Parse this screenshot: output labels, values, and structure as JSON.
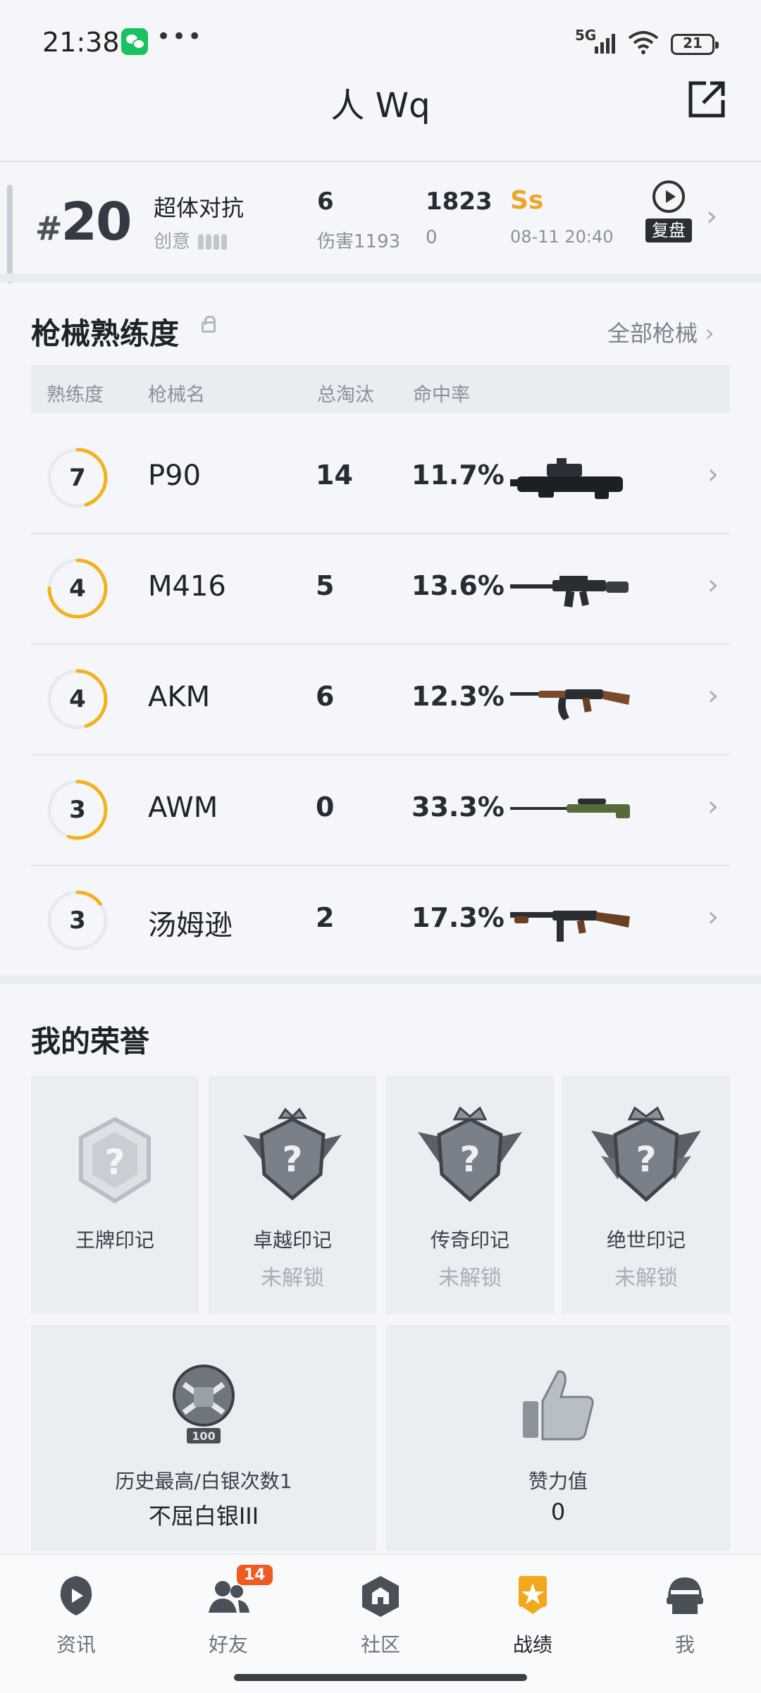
{
  "status_bar": {
    "time": "21:38",
    "network": "5G",
    "battery": "21"
  },
  "header": {
    "title": "人 Wq"
  },
  "match": {
    "rank": "20",
    "rank_hash": "#",
    "mode": "超体对抗",
    "submode": "创意",
    "kills": "6",
    "damage": "伤害1193",
    "score": "1823",
    "score_sub": "0",
    "grade": "Ss",
    "time": "08-11 20:40",
    "replay_label": "复盘"
  },
  "weapons": {
    "title": "枪械熟练度",
    "all_link": "全部枪械",
    "headers": {
      "mastery": "熟练度",
      "name": "枪械名",
      "kills": "总淘汰",
      "accuracy": "命中率"
    },
    "rows": [
      {
        "level": "7",
        "name": "P90",
        "kills": "14",
        "accuracy": "11.7%",
        "progress": 0.45
      },
      {
        "level": "4",
        "name": "M416",
        "kills": "5",
        "accuracy": "13.6%",
        "progress": 0.75
      },
      {
        "level": "4",
        "name": "AKM",
        "kills": "6",
        "accuracy": "12.3%",
        "progress": 0.45
      },
      {
        "level": "3",
        "name": "AWM",
        "kills": "0",
        "accuracy": "33.3%",
        "progress": 0.55
      },
      {
        "level": "3",
        "name": "汤姆逊",
        "kills": "2",
        "accuracy": "17.3%",
        "progress": 0.15
      }
    ]
  },
  "honors": {
    "title": "我的荣誉",
    "cards": [
      {
        "name": "王牌印记",
        "status": ""
      },
      {
        "name": "卓越印记",
        "status": "未解锁"
      },
      {
        "name": "传奇印记",
        "status": "未解锁"
      },
      {
        "name": "绝世印记",
        "status": "未解锁"
      }
    ],
    "history": {
      "label": "历史最高/白银次数1",
      "value": "不屈白银III",
      "badge_text": "100"
    },
    "praise": {
      "label": "赞力值",
      "value": "0"
    }
  },
  "tabbar": {
    "items": [
      {
        "label": "资讯"
      },
      {
        "label": "好友",
        "badge": "14"
      },
      {
        "label": "社区"
      },
      {
        "label": "战绩"
      },
      {
        "label": "我"
      }
    ]
  }
}
